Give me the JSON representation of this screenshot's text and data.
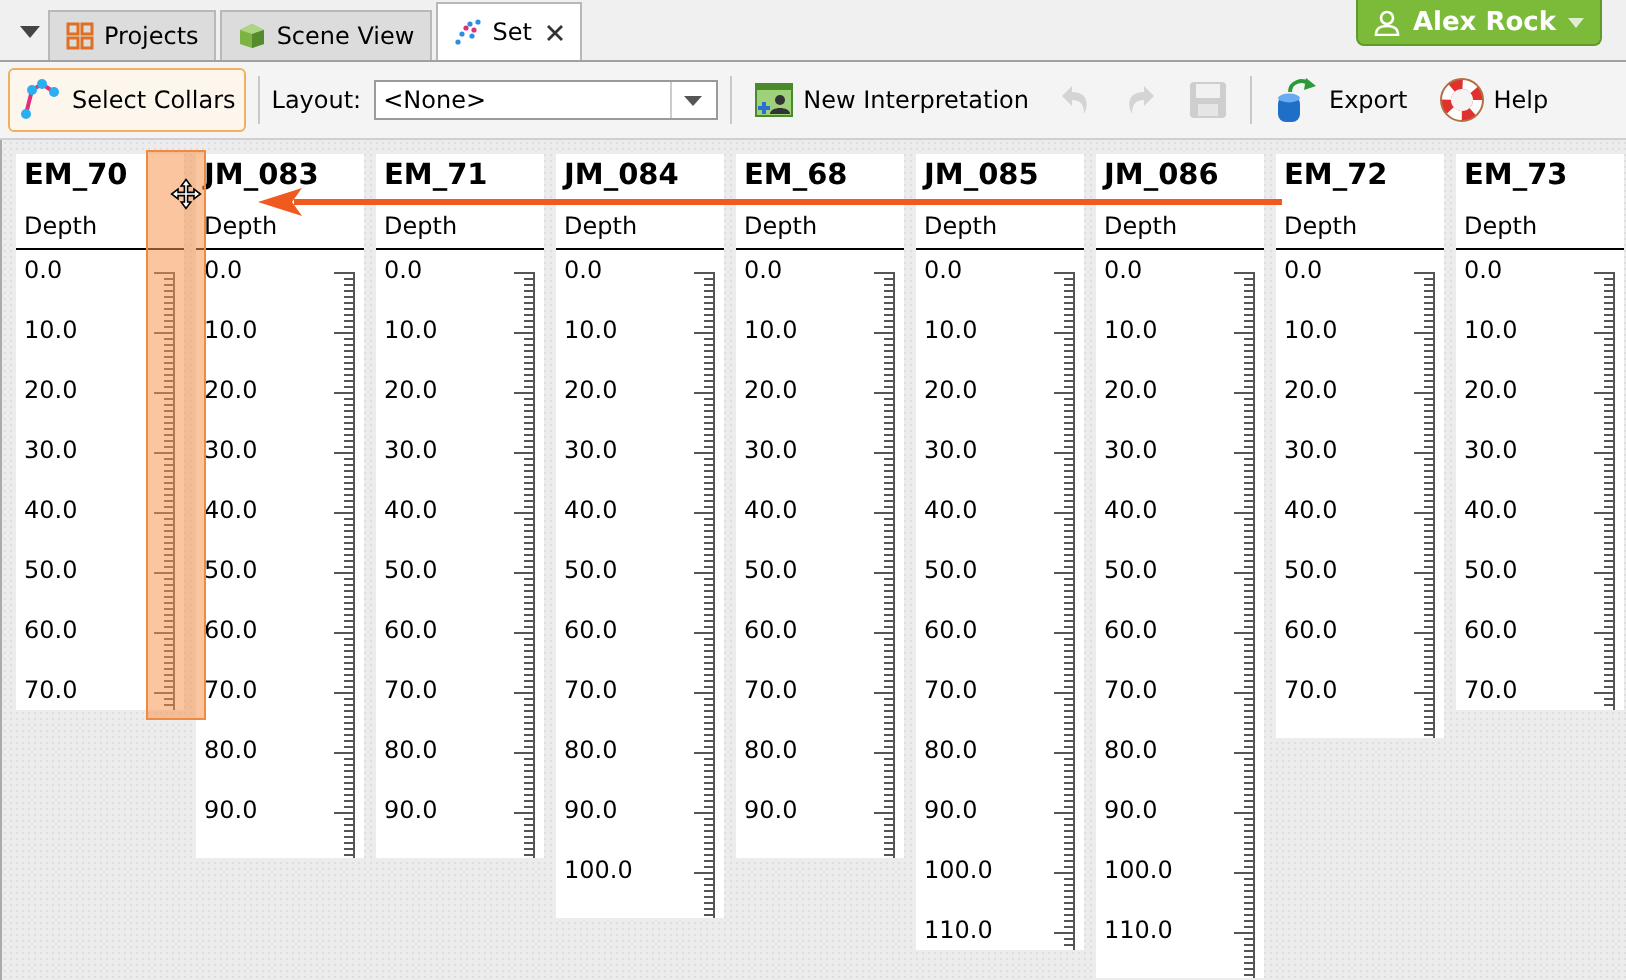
{
  "tabs": [
    {
      "label": "Projects",
      "selected": false,
      "closable": false
    },
    {
      "label": "Scene View",
      "selected": false,
      "closable": false
    },
    {
      "label": "Set",
      "selected": true,
      "closable": true
    }
  ],
  "user": {
    "name": "Alex Rock"
  },
  "toolbar": {
    "select_collars": {
      "label": "Select Collars",
      "selected": true
    },
    "layout": {
      "label": "Layout:",
      "value": "<None>"
    },
    "new_interpretation": {
      "label": "New Interpretation"
    },
    "undo": {
      "disabled": true
    },
    "redo": {
      "disabled": true
    },
    "save": {
      "disabled": true
    },
    "export": {
      "label": "Export"
    },
    "help": {
      "label": "Help"
    }
  },
  "columns": [
    {
      "name": "EM_70",
      "header": "Depth",
      "clipped": true,
      "labels": [
        "0.0",
        "10.0",
        "20.0",
        "30.0",
        "40.0",
        "50.0",
        "60.0",
        "70.0"
      ]
    },
    {
      "name": "JM_083",
      "header": "Depth",
      "clipped": false,
      "labels": [
        "0.0",
        "10.0",
        "20.0",
        "30.0",
        "40.0",
        "50.0",
        "60.0",
        "70.0",
        "80.0",
        "90.0"
      ]
    },
    {
      "name": "EM_71",
      "header": "Depth",
      "clipped": false,
      "labels": [
        "0.0",
        "10.0",
        "20.0",
        "30.0",
        "40.0",
        "50.0",
        "60.0",
        "70.0",
        "80.0",
        "90.0"
      ]
    },
    {
      "name": "JM_084",
      "header": "Depth",
      "clipped": false,
      "labels": [
        "0.0",
        "10.0",
        "20.0",
        "30.0",
        "40.0",
        "50.0",
        "60.0",
        "70.0",
        "80.0",
        "90.0",
        "100.0"
      ]
    },
    {
      "name": "EM_68",
      "header": "Depth",
      "clipped": false,
      "labels": [
        "0.0",
        "10.0",
        "20.0",
        "30.0",
        "40.0",
        "50.0",
        "60.0",
        "70.0",
        "80.0",
        "90.0"
      ]
    },
    {
      "name": "JM_085",
      "header": "Depth",
      "clipped": true,
      "labels": [
        "0.0",
        "10.0",
        "20.0",
        "30.0",
        "40.0",
        "50.0",
        "60.0",
        "70.0",
        "80.0",
        "90.0",
        "100.0",
        "110.0"
      ]
    },
    {
      "name": "JM_086",
      "header": "Depth",
      "clipped": false,
      "labels": [
        "0.0",
        "10.0",
        "20.0",
        "30.0",
        "40.0",
        "50.0",
        "60.0",
        "70.0",
        "80.0",
        "90.0",
        "100.0",
        "110.0"
      ]
    },
    {
      "name": "EM_72",
      "header": "Depth",
      "clipped": false,
      "labels": [
        "0.0",
        "10.0",
        "20.0",
        "30.0",
        "40.0",
        "50.0",
        "60.0",
        "70.0"
      ]
    },
    {
      "name": "EM_73",
      "header": "Depth",
      "clipped": true,
      "labels": [
        "0.0",
        "10.0",
        "20.0",
        "30.0",
        "40.0",
        "50.0",
        "60.0",
        "70.0"
      ]
    }
  ]
}
